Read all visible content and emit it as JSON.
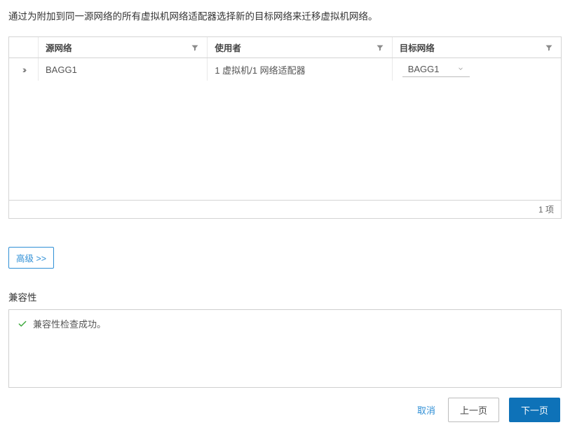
{
  "instruction": "通过为附加到同一源网络的所有虚拟机网络适配器选择新的目标网络来迁移虚拟机网络。",
  "table": {
    "headers": {
      "source": "源网络",
      "usedBy": "使用者",
      "target": "目标网络"
    },
    "rows": [
      {
        "source": "BAGG1",
        "usedBy": "1 虚拟机/1 网络适配器",
        "target": "BAGG1"
      }
    ],
    "footer": "1 项"
  },
  "advanced": {
    "label": "高级 >>"
  },
  "compat": {
    "heading": "兼容性",
    "message": "兼容性检查成功。"
  },
  "footer": {
    "cancel": "取消",
    "back": "上一页",
    "next": "下一页"
  }
}
